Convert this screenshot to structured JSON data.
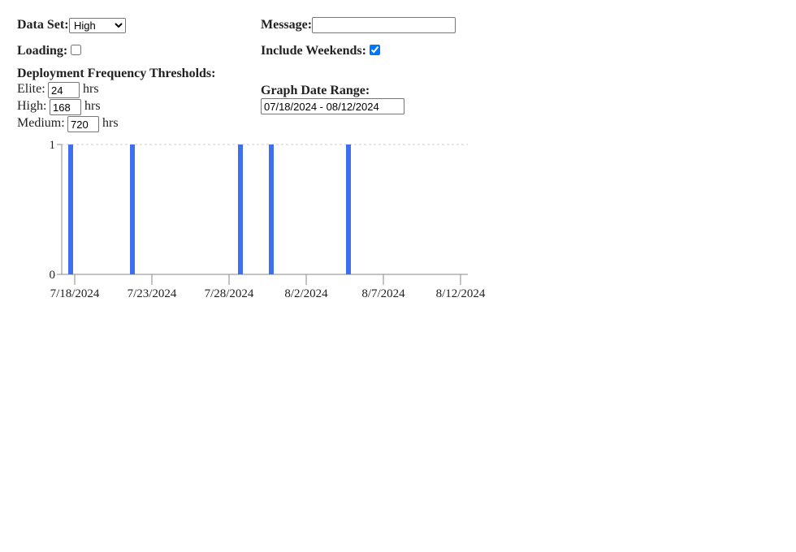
{
  "controls": {
    "dataset_label": "Data Set:",
    "dataset_selected": "High",
    "message_label": "Message:",
    "message_value": "",
    "loading_label": "Loading:",
    "loading_checked": false,
    "weekends_label": "Include Weekends:",
    "weekends_checked": true,
    "thresholds_heading": "Deployment Frequency Thresholds:",
    "elite_label": "Elite:",
    "elite_value": "24",
    "high_label": "High:",
    "high_value": "168",
    "medium_label": "Medium:",
    "medium_value": "720",
    "unit": "hrs",
    "date_range_label": "Graph Date Range:",
    "date_range_value": "07/18/2024 - 08/12/2024"
  },
  "colors": {
    "bar": "#3e6ff0",
    "axis": "#8a8a8a",
    "gridline": "#cccccc"
  },
  "chart_data": {
    "type": "bar",
    "x_start": "2024-07-18",
    "x_end": "2024-08-12",
    "xtick_labels": [
      "7/18/2024",
      "7/23/2024",
      "7/28/2024",
      "8/2/2024",
      "8/7/2024",
      "8/12/2024"
    ],
    "ytick_labels": [
      "0",
      "1"
    ],
    "ylim": [
      0,
      1
    ],
    "points": [
      {
        "x": "2024-07-18",
        "y": 1
      },
      {
        "x": "2024-07-22",
        "y": 1
      },
      {
        "x": "2024-07-29",
        "y": 1
      },
      {
        "x": "2024-07-31",
        "y": 1
      },
      {
        "x": "2024-08-05",
        "y": 1
      }
    ],
    "grid": "dashed horizontal at max"
  }
}
